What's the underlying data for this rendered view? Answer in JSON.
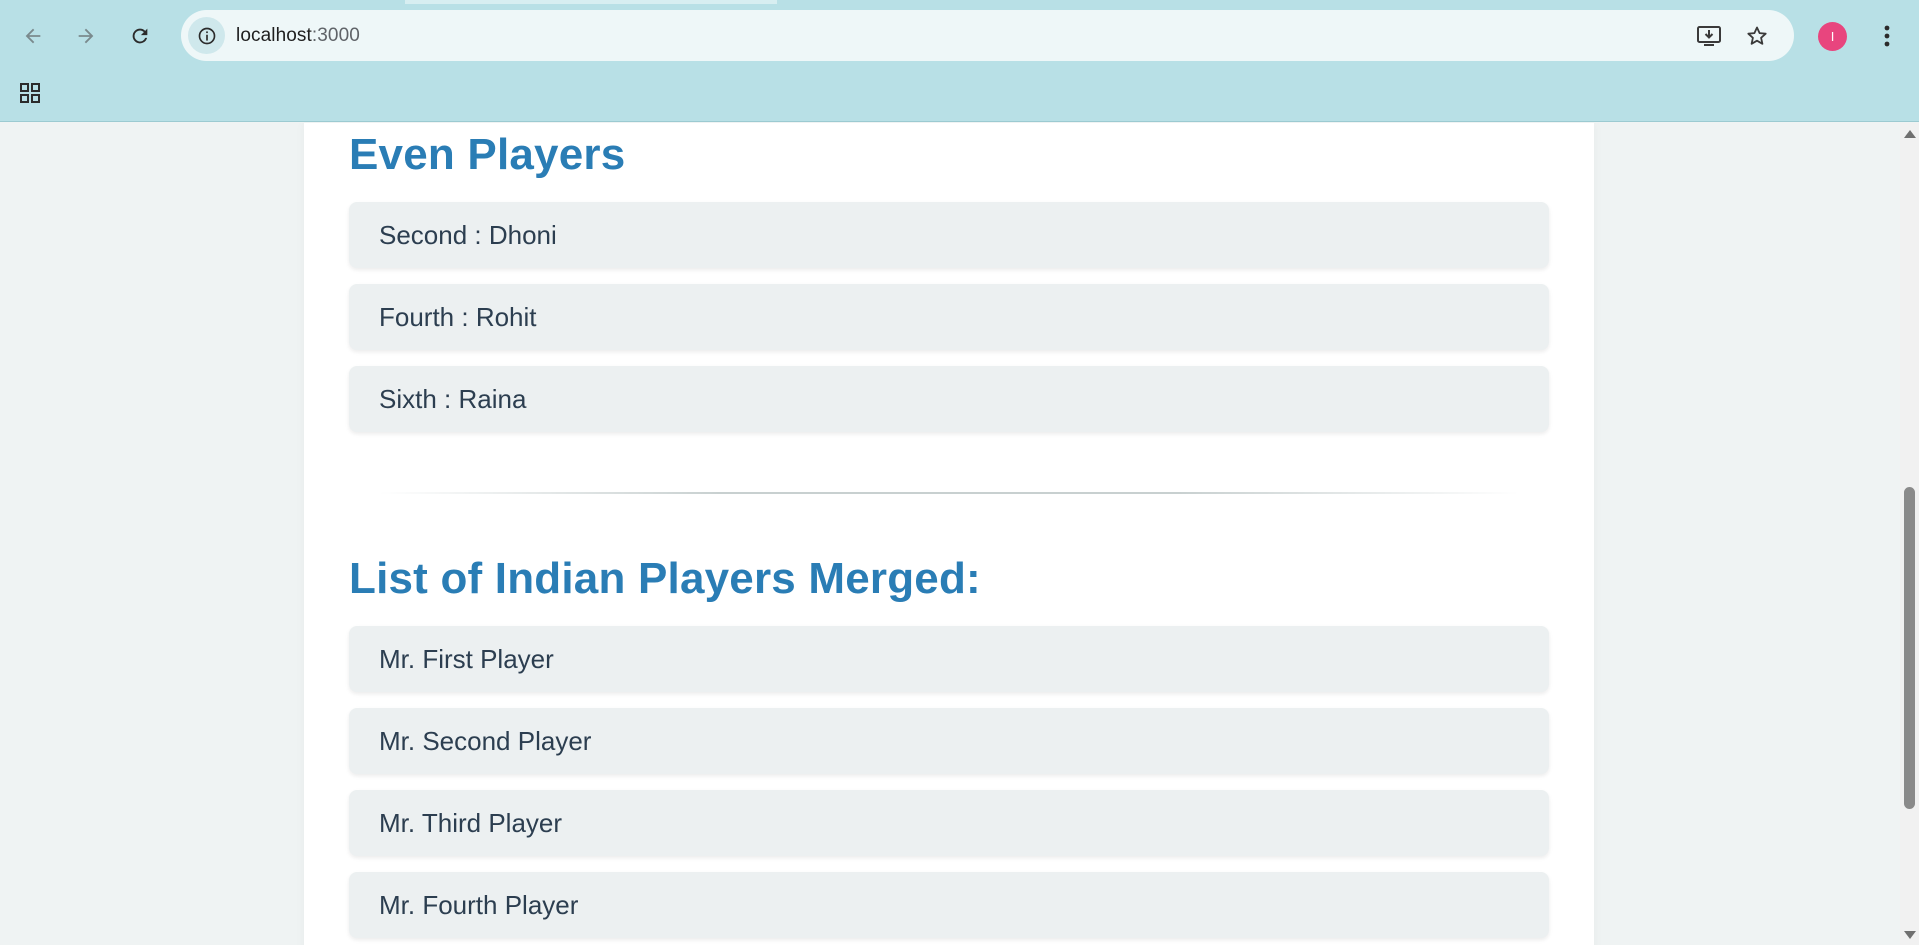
{
  "browser": {
    "url_host": "localhost",
    "url_port": ":3000",
    "profile_initial": "I",
    "icons": [
      "back-arrow-icon",
      "forward-arrow-icon",
      "reload-icon",
      "info-icon",
      "install-app-icon",
      "bookmark-star-icon",
      "more-vert-icon",
      "apps-grid-icon"
    ]
  },
  "page": {
    "even_title": "Even Players",
    "even_players": [
      "Second : Dhoni",
      "Fourth : Rohit",
      "Sixth : Raina"
    ],
    "merged_title": "List of Indian Players Merged:",
    "merged_players": [
      "Mr. First Player",
      "Mr. Second Player",
      "Mr. Third Player",
      "Mr. Fourth Player"
    ]
  },
  "colors": {
    "chrome": "#b8e0e6",
    "heading": "#2a7db5",
    "item_bg": "#ecf0f1",
    "item_text": "#2c3e50",
    "profile": "#e8457e"
  }
}
